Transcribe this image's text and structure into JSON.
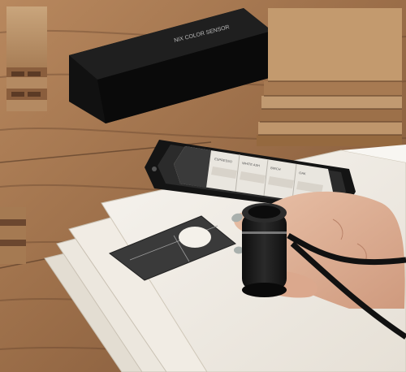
{
  "photo": {
    "subject": "color-measurement device with phone app on wooden table",
    "colors": {
      "wood_light": "#a87a55",
      "wood_dark": "#6e4a32",
      "paper": "#f1ede6",
      "device_black": "#1c1c1c",
      "screen": "#e9e6df",
      "skin": "#e3b49a",
      "nail": "#a9b0ad"
    }
  },
  "box": {
    "brand_text": "NIX COLOR SENSOR"
  },
  "phone": {
    "app_columns": [
      {
        "header": "ESPRESSO"
      },
      {
        "header": "WHITE ASH"
      },
      {
        "header": "BIRCH"
      },
      {
        "header": "OAK"
      }
    ]
  },
  "card": {
    "label": ""
  }
}
